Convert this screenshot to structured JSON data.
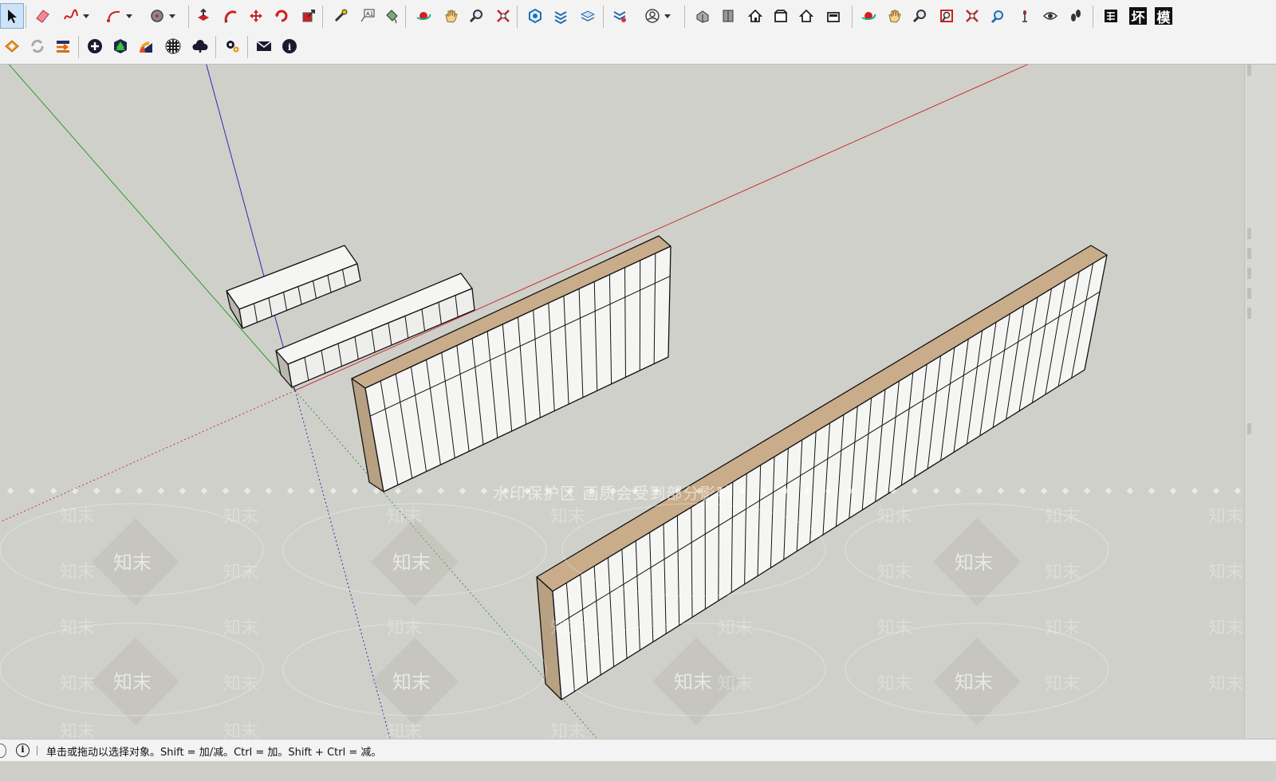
{
  "toolbar": {
    "row1": [
      {
        "name": "select-tool-button",
        "icon": "arrow-cursor-icon",
        "active": true
      },
      {
        "name": "eraser-tool-button",
        "icon": "eraser-icon"
      },
      {
        "name": "freehand-tool-button",
        "icon": "freehand-curve-icon",
        "dropdown": true
      },
      {
        "name": "arc-tool-button",
        "icon": "arc-icon",
        "dropdown": true
      },
      {
        "name": "circle-tool-button",
        "icon": "circle-icon",
        "dropdown": true
      },
      {
        "name": "push-pull-tool-button",
        "icon": "push-pull-icon"
      },
      {
        "name": "follow-me-tool-button",
        "icon": "follow-me-icon"
      },
      {
        "name": "move-tool-button",
        "icon": "move-arrows-icon"
      },
      {
        "name": "rotate-tool-button",
        "icon": "rotate-icon"
      },
      {
        "name": "scale-tool-button",
        "icon": "scale-icon"
      },
      {
        "name": "tape-measure-tool-button",
        "icon": "tape-measure-icon"
      },
      {
        "name": "text-tool-button",
        "icon": "text-label-icon"
      },
      {
        "name": "paint-bucket-tool-button",
        "icon": "paint-bucket-icon"
      },
      {
        "name": "orbit-tool-button",
        "icon": "orbit-icon"
      },
      {
        "name": "pan-tool-button",
        "icon": "hand-pan-icon"
      },
      {
        "name": "zoom-tool-button",
        "icon": "magnifier-icon"
      },
      {
        "name": "zoom-extents-button",
        "icon": "zoom-extents-icon"
      },
      {
        "name": "warehouse-button",
        "icon": "warehouse-icon"
      },
      {
        "name": "extension-warehouse-button",
        "icon": "extension-icon"
      },
      {
        "name": "layers-button",
        "icon": "layers-icon"
      },
      {
        "name": "extension-manager-button",
        "icon": "extension-manager-icon"
      },
      {
        "name": "account-button",
        "icon": "user-account-icon",
        "dropdown": true
      },
      {
        "name": "iso-view-button",
        "icon": "iso-house-icon"
      },
      {
        "name": "top-view-button",
        "icon": "top-view-icon"
      },
      {
        "name": "front-view-button",
        "icon": "front-house-icon"
      },
      {
        "name": "right-view-button",
        "icon": "right-view-icon"
      },
      {
        "name": "back-view-button",
        "icon": "back-house-icon"
      },
      {
        "name": "left-view-button",
        "icon": "left-view-icon"
      },
      {
        "name": "orbit-tool-2-button",
        "icon": "orbit-icon"
      },
      {
        "name": "pan-tool-2-button",
        "icon": "hand-pan-icon"
      },
      {
        "name": "zoom-tool-2-button",
        "icon": "magnifier-icon"
      },
      {
        "name": "zoom-window-button",
        "icon": "zoom-window-icon"
      },
      {
        "name": "zoom-extents-2-button",
        "icon": "zoom-extents-icon"
      },
      {
        "name": "previous-view-button",
        "icon": "previous-view-icon"
      },
      {
        "name": "position-camera-button",
        "icon": "position-camera-icon"
      },
      {
        "name": "look-around-button",
        "icon": "eye-icon"
      },
      {
        "name": "walk-button",
        "icon": "footsteps-icon"
      },
      {
        "name": "plugin-grid-button",
        "icon": "grid-table-icon"
      },
      {
        "name": "plugin-huan-button",
        "text": "坏"
      },
      {
        "name": "plugin-mo-button",
        "text": "模"
      }
    ],
    "row2": [
      {
        "name": "plugin-orange-button",
        "icon": "orange-sketch-icon"
      },
      {
        "name": "refresh-button",
        "icon": "refresh-icon"
      },
      {
        "name": "transfer-button",
        "icon": "transfer-arrows-icon"
      },
      {
        "name": "add-button",
        "icon": "plus-circle-icon"
      },
      {
        "name": "tree-button",
        "icon": "tree-hexagon-icon"
      },
      {
        "name": "sunset-button",
        "icon": "sunset-icon"
      },
      {
        "name": "material-button",
        "icon": "checker-sphere-icon"
      },
      {
        "name": "cloud-upload-button",
        "icon": "cloud-upload-icon"
      },
      {
        "name": "settings-button",
        "icon": "gear-icon"
      },
      {
        "name": "mail-button",
        "icon": "mail-icon"
      },
      {
        "name": "info-button",
        "icon": "info-icon"
      }
    ]
  },
  "status": {
    "message": "单击或拖动以选择对象。Shift = 加/减。Ctrl = 加。Shift + Ctrl = 减。",
    "icon": "info-icon"
  },
  "watermark": {
    "banner": "水印保护区   画质会受到部分影响",
    "repeat": "知末"
  },
  "colors": {
    "background": "#d0d0ca",
    "box_face": "#f4f4f2",
    "box_side": "#c9ac8a",
    "edge": "#111111",
    "axis_red": "#c83232",
    "axis_green": "#2e9a2e",
    "axis_blue": "#2a2ab8"
  }
}
